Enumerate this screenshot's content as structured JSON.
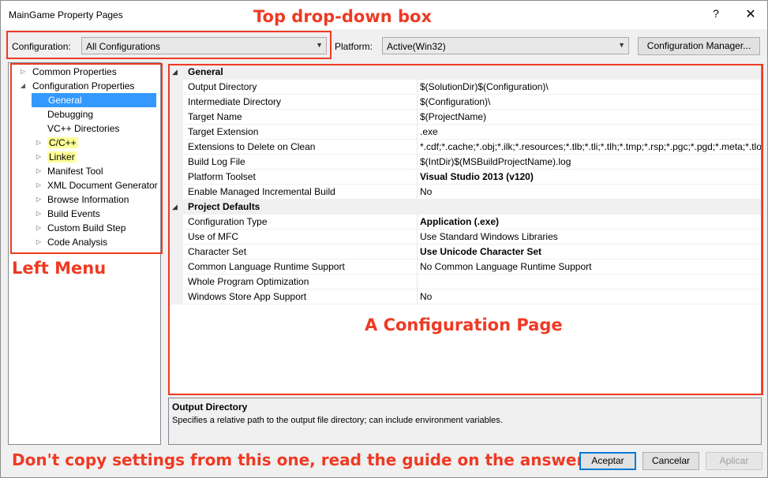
{
  "window": {
    "title": "MainGame Property Pages",
    "help_glyph": "?",
    "close_glyph": "✕"
  },
  "annotations": {
    "top": "Top drop-down box",
    "left": "Left Menu",
    "page": "A Configuration Page",
    "bottom": "Don't copy settings from this one, read the guide on the answer!",
    "color": "#ee3a24"
  },
  "toolbar": {
    "configuration_label": "Configuration:",
    "configuration_value": "All Configurations",
    "platform_label": "Platform:",
    "platform_value": "Active(Win32)",
    "config_manager_label": "Configuration Manager..."
  },
  "tree": {
    "items": [
      {
        "label": "Common Properties",
        "expander": "▷",
        "highlight": false,
        "selected": false
      },
      {
        "label": "Configuration Properties",
        "expander": "◢",
        "highlight": false,
        "selected": false
      },
      {
        "label": "General",
        "expander": "",
        "highlight": false,
        "selected": true
      },
      {
        "label": "Debugging",
        "expander": "",
        "highlight": false,
        "selected": false
      },
      {
        "label": "VC++ Directories",
        "expander": "",
        "highlight": false,
        "selected": false
      },
      {
        "label": "C/C++",
        "expander": "▷",
        "highlight": true,
        "selected": false
      },
      {
        "label": "Linker",
        "expander": "▷",
        "highlight": true,
        "selected": false
      },
      {
        "label": "Manifest Tool",
        "expander": "▷",
        "highlight": false,
        "selected": false
      },
      {
        "label": "XML Document Generator",
        "expander": "▷",
        "highlight": false,
        "selected": false
      },
      {
        "label": "Browse Information",
        "expander": "▷",
        "highlight": false,
        "selected": false
      },
      {
        "label": "Build Events",
        "expander": "▷",
        "highlight": false,
        "selected": false
      },
      {
        "label": "Custom Build Step",
        "expander": "▷",
        "highlight": false,
        "selected": false
      },
      {
        "label": "Code Analysis",
        "expander": "▷",
        "highlight": false,
        "selected": false
      }
    ],
    "selected_color": "#3399ff",
    "highlight_color": "#ffff99"
  },
  "grid": {
    "rows": [
      {
        "section": true,
        "name": "General",
        "value": ""
      },
      {
        "section": false,
        "name": "Output Directory",
        "value": "$(SolutionDir)$(Configuration)\\",
        "bold": false
      },
      {
        "section": false,
        "name": "Intermediate Directory",
        "value": "$(Configuration)\\",
        "bold": false
      },
      {
        "section": false,
        "name": "Target Name",
        "value": "$(ProjectName)",
        "bold": false
      },
      {
        "section": false,
        "name": "Target Extension",
        "value": ".exe",
        "bold": false
      },
      {
        "section": false,
        "name": "Extensions to Delete on Clean",
        "value": "*.cdf;*.cache;*.obj;*.ilk;*.resources;*.tlb;*.tli;*.tlh;*.tmp;*.rsp;*.pgc;*.pgd;*.meta;*.tlog",
        "bold": false
      },
      {
        "section": false,
        "name": "Build Log File",
        "value": "$(IntDir)$(MSBuildProjectName).log",
        "bold": false
      },
      {
        "section": false,
        "name": "Platform Toolset",
        "value": "Visual Studio 2013 (v120)",
        "bold": true
      },
      {
        "section": false,
        "name": "Enable Managed Incremental Build",
        "value": "No",
        "bold": false
      },
      {
        "section": true,
        "name": "Project Defaults",
        "value": ""
      },
      {
        "section": false,
        "name": "Configuration Type",
        "value": "Application (.exe)",
        "bold": true
      },
      {
        "section": false,
        "name": "Use of MFC",
        "value": "Use Standard Windows Libraries",
        "bold": false
      },
      {
        "section": false,
        "name": "Character Set",
        "value": "Use Unicode Character Set",
        "bold": true
      },
      {
        "section": false,
        "name": "Common Language Runtime Support",
        "value": "No Common Language Runtime Support",
        "bold": false
      },
      {
        "section": false,
        "name": "Whole Program Optimization",
        "value": "",
        "bold": false
      },
      {
        "section": false,
        "name": "Windows Store App Support",
        "value": "No",
        "bold": false
      }
    ],
    "section_caret": "◢"
  },
  "description": {
    "title": "Output Directory",
    "text": "Specifies a relative path to the output file directory; can include environment variables."
  },
  "buttons": {
    "accept": "Aceptar",
    "cancel": "Cancelar",
    "apply": "Aplicar"
  }
}
